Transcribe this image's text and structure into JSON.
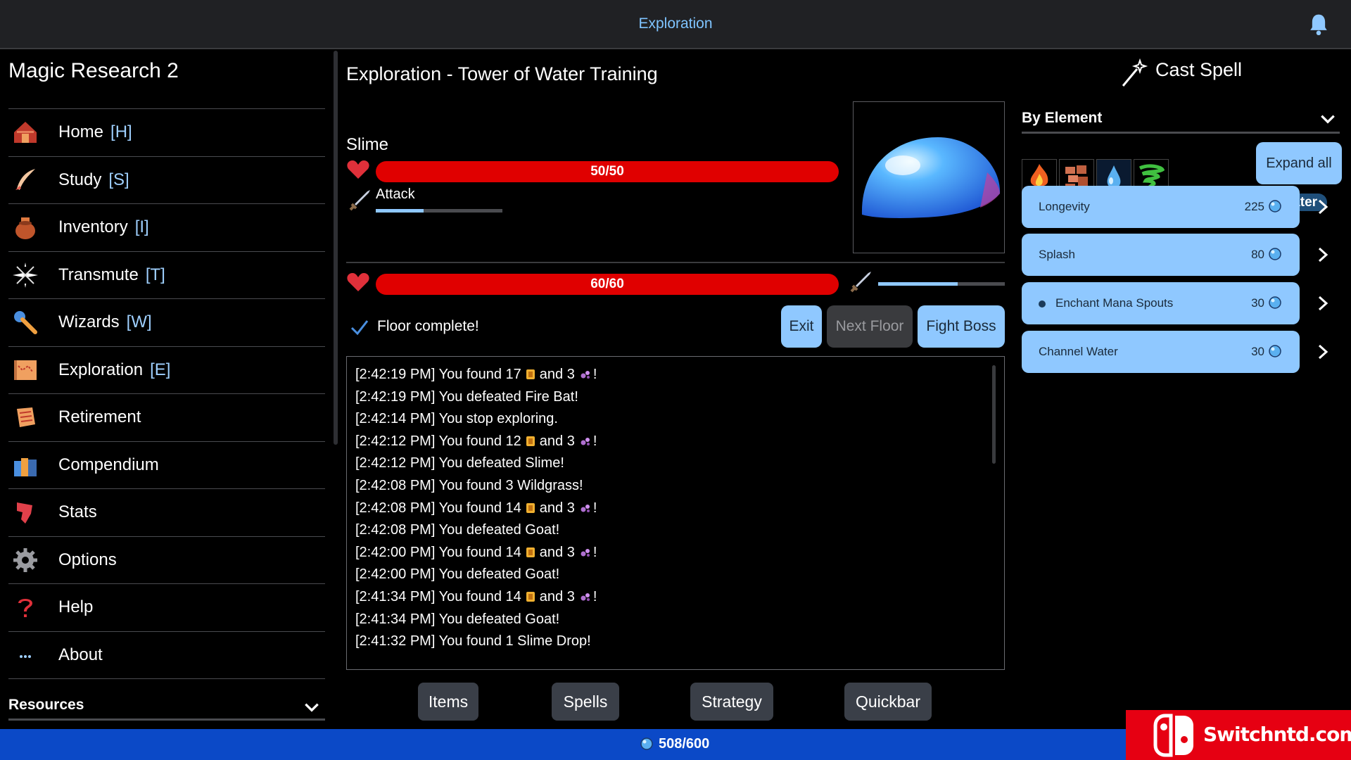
{
  "topbar": {
    "title": "Exploration"
  },
  "app": {
    "title": "Magic Research 2"
  },
  "sidebar": {
    "items": [
      {
        "label": "Home",
        "key": "[H]",
        "icon": "home-icon"
      },
      {
        "label": "Study",
        "key": "[S]",
        "icon": "quill-icon"
      },
      {
        "label": "Inventory",
        "key": "[I]",
        "icon": "pot-icon"
      },
      {
        "label": "Transmute",
        "key": "[T]",
        "icon": "sparkle-icon"
      },
      {
        "label": "Wizards",
        "key": "[W]",
        "icon": "wand-icon"
      },
      {
        "label": "Exploration",
        "key": "[E]",
        "icon": "map-icon"
      },
      {
        "label": "Retirement",
        "key": "",
        "icon": "scroll-icon"
      },
      {
        "label": "Compendium",
        "key": "",
        "icon": "books-icon"
      },
      {
        "label": "Stats",
        "key": "",
        "icon": "stats-icon"
      },
      {
        "label": "Options",
        "key": "",
        "icon": "gear-icon"
      },
      {
        "label": "Help",
        "key": "",
        "icon": "question-icon"
      },
      {
        "label": "About",
        "key": "",
        "icon": "ellipsis-icon"
      }
    ],
    "resources_label": "Resources"
  },
  "main": {
    "title": "Exploration - Tower of Water Training",
    "enemy": {
      "name": "Slime",
      "hp_text": "50/50",
      "hp_fraction": 1.0,
      "action_label": "Attack",
      "action_progress": 0.38
    },
    "player": {
      "hp_text": "60/60",
      "hp_fraction": 1.0,
      "attack_progress": 0.63
    },
    "floor_message": "Floor complete!",
    "buttons": {
      "exit": "Exit",
      "next_floor": "Next Floor",
      "fight_boss": "Fight Boss"
    },
    "log": [
      {
        "before": "[2:42:19 PM] You found 17",
        "mid": "and 3",
        "after": "!",
        "icons": true
      },
      {
        "before": "[2:42:19 PM] You defeated Fire Bat!",
        "icons": false
      },
      {
        "before": "[2:42:14 PM] You stop exploring.",
        "icons": false
      },
      {
        "before": "[2:42:12 PM] You found 12",
        "mid": "and 3",
        "after": "!",
        "icons": true
      },
      {
        "before": "[2:42:12 PM] You defeated Slime!",
        "icons": false
      },
      {
        "before": "[2:42:08 PM] You found 3 Wildgrass!",
        "icons": false
      },
      {
        "before": "[2:42:08 PM] You found 14",
        "mid": "and 3",
        "after": "!",
        "icons": true
      },
      {
        "before": "[2:42:08 PM] You defeated Goat!",
        "icons": false
      },
      {
        "before": "[2:42:00 PM] You found 14",
        "mid": "and 3",
        "after": "!",
        "icons": true
      },
      {
        "before": "[2:42:00 PM] You defeated Goat!",
        "icons": false
      },
      {
        "before": "[2:41:34 PM] You found 14",
        "mid": "and 3",
        "after": "!",
        "icons": true
      },
      {
        "before": "[2:41:34 PM] You defeated Goat!",
        "icons": false
      },
      {
        "before": "[2:41:32 PM] You found 1 Slime Drop!",
        "icons": false
      }
    ],
    "tabs": {
      "items": "Items",
      "spells": "Spells",
      "strategy": "Strategy",
      "quickbar": "Quickbar"
    }
  },
  "cast": {
    "title": "Cast Spell",
    "filter_label": "By Element",
    "elements": [
      "fire-element-icon",
      "earth-element-icon",
      "water-element-icon",
      "air-element-icon"
    ],
    "expand_label": "Expand all",
    "current_element": "Water",
    "spells": [
      {
        "name": "Longevity",
        "cost": "225",
        "active": false
      },
      {
        "name": "Splash",
        "cost": "80",
        "active": false
      },
      {
        "name": "Enchant Mana Spouts",
        "cost": "30",
        "active": true
      },
      {
        "name": "Channel Water",
        "cost": "30",
        "active": false
      }
    ]
  },
  "status": {
    "mana": "508/600"
  },
  "watermark": {
    "text": "Switchntd.com"
  },
  "colors": {
    "accent": "#8fc8ff",
    "hp": "#e00000",
    "bottom_bar": "#0b49c7",
    "title_blue": "#7fc4ff"
  }
}
